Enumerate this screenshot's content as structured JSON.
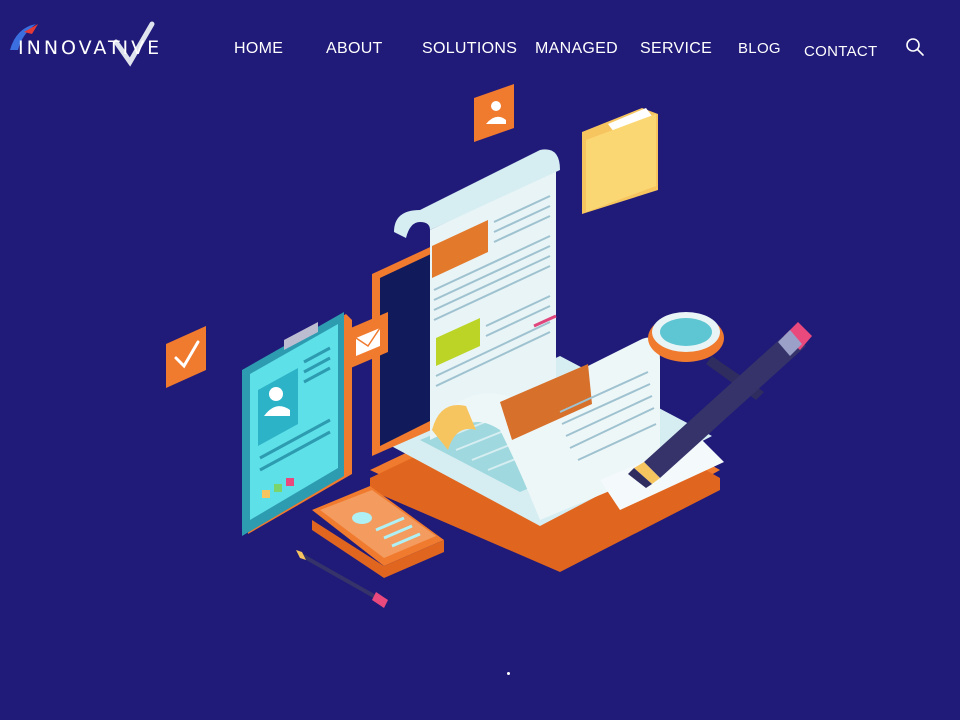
{
  "brand": {
    "logo_text": "INNOVATIVE"
  },
  "nav": {
    "items": [
      {
        "label": "HOME"
      },
      {
        "label": "ABOUT"
      },
      {
        "label": "SOLUTIONS"
      },
      {
        "label": "MANAGED"
      },
      {
        "label": "SERVICE"
      },
      {
        "label": "BLOG"
      },
      {
        "label": "CONTACT"
      }
    ]
  },
  "icons": {
    "search": "search-icon",
    "hero": "document-illustration"
  },
  "colors": {
    "background": "#201a78",
    "accent_orange": "#f07a2e",
    "accent_cyan": "#5ee0e8",
    "paper": "#e8f4f6",
    "pencil": "#35336a"
  }
}
